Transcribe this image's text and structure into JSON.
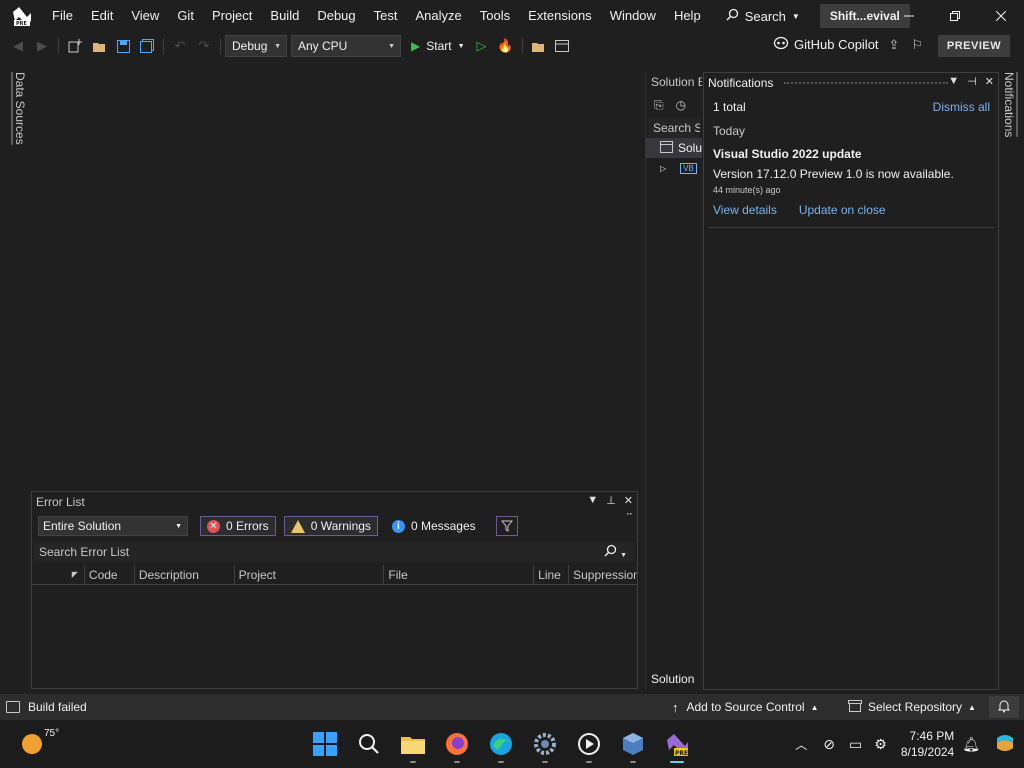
{
  "menu": {
    "items": [
      "File",
      "Edit",
      "View",
      "Git",
      "Project",
      "Build",
      "Debug",
      "Test",
      "Analyze",
      "Tools",
      "Extensions",
      "Window",
      "Help"
    ],
    "search_label": "Search",
    "solution_name": "Shift...evival"
  },
  "toolbar": {
    "config": "Debug",
    "platform": "Any CPU",
    "start_label": "Start",
    "copilot_label": "GitHub Copilot",
    "preview_label": "PREVIEW"
  },
  "left_tab": {
    "label": "Data Sources"
  },
  "right_tab": {
    "label": "Notifications"
  },
  "error_list": {
    "title": "Error List",
    "scope": "Entire Solution",
    "errors_label": "0 Errors",
    "warnings_label": "0 Warnings",
    "messages_label": "0 Messages",
    "search_placeholder": "Search Error List",
    "columns": [
      "Code",
      "Description",
      "Project",
      "File",
      "Line",
      "Suppression"
    ]
  },
  "solution_explorer": {
    "title": "Solution E",
    "search_placeholder": "Search So",
    "root_label": "Solu",
    "project_badge": "VB",
    "footer_label": "Solution"
  },
  "notifications": {
    "title": "Notifications",
    "count": "1 total",
    "dismiss_all": "Dismiss all",
    "group": "Today",
    "item": {
      "title": "Visual Studio 2022 update",
      "body": "Version 17.12.0 Preview 1.0 is now available.",
      "time": "44 minute(s) ago",
      "link_details": "View details",
      "link_update": "Update on close"
    }
  },
  "status_bar": {
    "build_status": "Build failed",
    "source_control": "Add to Source Control",
    "repository": "Select Repository"
  },
  "taskbar": {
    "temperature": "75°",
    "time": "7:46 PM",
    "date": "8/19/2024"
  },
  "colors": {
    "accent": "#7bb3f0",
    "error": "#e05252",
    "warning": "#e8c46a",
    "info": "#3794ff",
    "run": "#3fb950",
    "vs_purple": "#9b6bd4"
  }
}
